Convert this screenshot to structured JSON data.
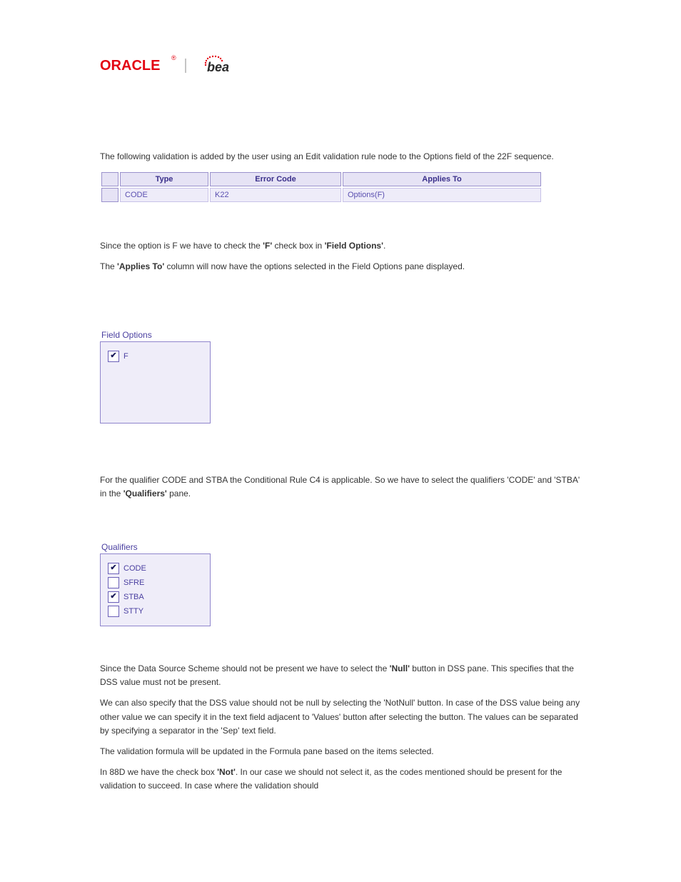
{
  "logo": {
    "oracle_text": "ORACLE",
    "bea_text": "bea"
  },
  "para1": "The following validation is added by the user using an Edit validation rule node to the Options field of the 22F sequence.",
  "table": {
    "headers": {
      "type": "Type",
      "error_code": "Error Code",
      "applies_to": "Applies To"
    },
    "row": {
      "type": "CODE",
      "error_code": "K22",
      "applies_to": "Options(F)"
    }
  },
  "para2_prefix": "Since the option is F we have to check the",
  "para2_bold": "'F'",
  "para2_mid": " check box in ",
  "para2_bold2": "'Field Options'",
  "para2_after": ".",
  "para3_prefix": "The ",
  "para3_bold": "'Applies To'",
  "para3_after": " column will now have the options selected in the Field Options pane displayed.",
  "panel_field_options": {
    "title": "Field Options",
    "items": [
      {
        "label": "F",
        "checked": true
      }
    ]
  },
  "para4_prefix": "For the qualifier CODE and STBA the Conditional Rule C4 is applicable. So we have to select the qualifiers 'CODE' and 'STBA' in the ",
  "para4_bold": "'Qualifiers'",
  "para4_after": " pane.",
  "panel_qualifiers": {
    "title": "Qualifiers",
    "items": [
      {
        "label": "CODE",
        "checked": true
      },
      {
        "label": "SFRE",
        "checked": false
      },
      {
        "label": "STBA",
        "checked": true
      },
      {
        "label": "STTY",
        "checked": false
      }
    ]
  },
  "para5_prefix": "Since the Data Source Scheme should not be present we have to select the ",
  "para5_bold": "'Null'",
  "para5_after": " button in DSS pane. This specifies that the DSS value must not be present.",
  "para6": "We can also specify that the DSS value should not be null by selecting the 'NotNull' button. In case of the DSS value being any other value we can specify it in the text field adjacent to 'Values' button after selecting the button. The values can be separated by specifying a separator in the 'Sep' text field.",
  "para7": "The validation formula will be updated in the Formula pane based on the items selected.",
  "para8_prefix": "In 88D we have the check box ",
  "para8_bold": "'Not'",
  "para8_after": ". In our case we should not select it, as the codes mentioned should be present for the validation to succeed. In case where the validation should"
}
